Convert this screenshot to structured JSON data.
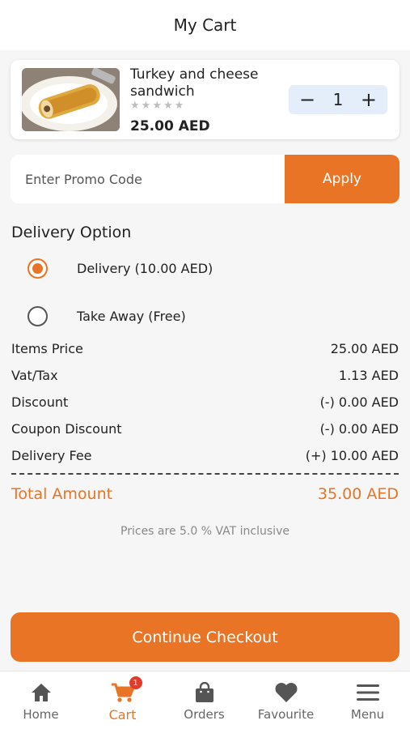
{
  "header": {
    "title": "My Cart"
  },
  "cart_item": {
    "name": "Turkey and cheese sandwich",
    "rating": 0,
    "max_rating": 5,
    "price": "25.00 AED",
    "quantity": "1",
    "minus_symbol": "−",
    "plus_symbol": "+"
  },
  "promo": {
    "placeholder": "Enter Promo Code",
    "value": "",
    "apply_label": "Apply"
  },
  "delivery": {
    "title": "Delivery Option",
    "options": [
      {
        "label": "Delivery (10.00 AED)",
        "selected": true
      },
      {
        "label": "Take Away (Free)",
        "selected": false
      }
    ]
  },
  "summary": {
    "rows": [
      {
        "label": "Items Price",
        "value": "25.00 AED"
      },
      {
        "label": "Vat/Tax",
        "value": "1.13 AED"
      },
      {
        "label": "Discount",
        "value": "(-) 0.00 AED"
      },
      {
        "label": "Coupon Discount",
        "value": "(-) 0.00 AED"
      },
      {
        "label": "Delivery Fee",
        "value": "(+) 10.00 AED"
      }
    ],
    "total_label": "Total Amount",
    "total_value": "35.00 AED",
    "vat_note": "Prices are 5.0 % VAT inclusive"
  },
  "checkout": {
    "label": "Continue Checkout"
  },
  "bottom_nav": {
    "items": [
      {
        "label": "Home",
        "icon": "home-icon",
        "active": false
      },
      {
        "label": "Cart",
        "icon": "cart-icon",
        "active": true,
        "badge": "1"
      },
      {
        "label": "Orders",
        "icon": "bag-icon",
        "active": false
      },
      {
        "label": "Favourite",
        "icon": "heart-icon",
        "active": false
      },
      {
        "label": "Menu",
        "icon": "menu-icon",
        "active": false
      }
    ]
  },
  "colors": {
    "accent": "#ea7425",
    "badge": "#e23b2e",
    "stepper_bg": "#e4eefb"
  }
}
